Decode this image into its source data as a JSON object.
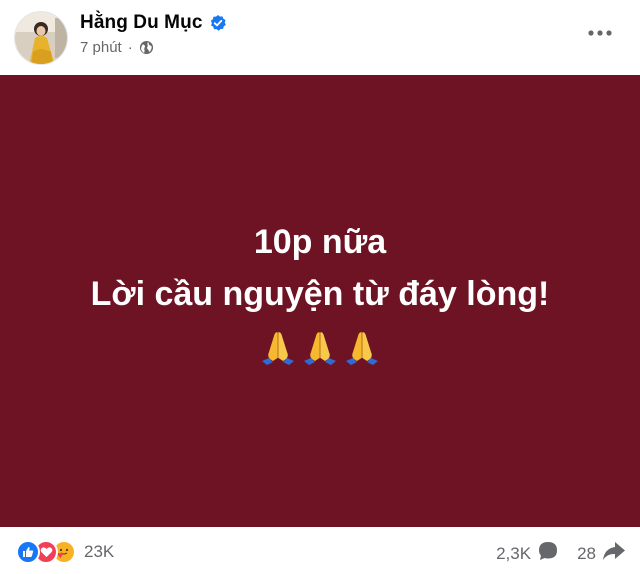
{
  "post": {
    "author_name": "Hằng Du Mục",
    "time": "7 phút",
    "separator": "·",
    "text_line1": "10p nữa",
    "text_line2": "Lời cầu nguyện từ đáy lòng!",
    "emoji_count": 3,
    "background_color": "#6e1324",
    "icons": {
      "verified": "verified-badge-icon",
      "privacy": "globe-icon",
      "more": "more-options-icon",
      "emoji": "folded-hands-emoji"
    }
  },
  "footer": {
    "reaction_types": [
      "like",
      "love",
      "care"
    ],
    "reaction_count": "23K",
    "comment_count": "2,3K",
    "share_count": "28",
    "icons": {
      "comment": "comment-icon",
      "share": "share-icon"
    }
  },
  "colors": {
    "like": "#1877f2",
    "love": "#f33e58",
    "care": "#f7b125",
    "verified": "#1877f2",
    "secondary_text": "#65676b"
  }
}
